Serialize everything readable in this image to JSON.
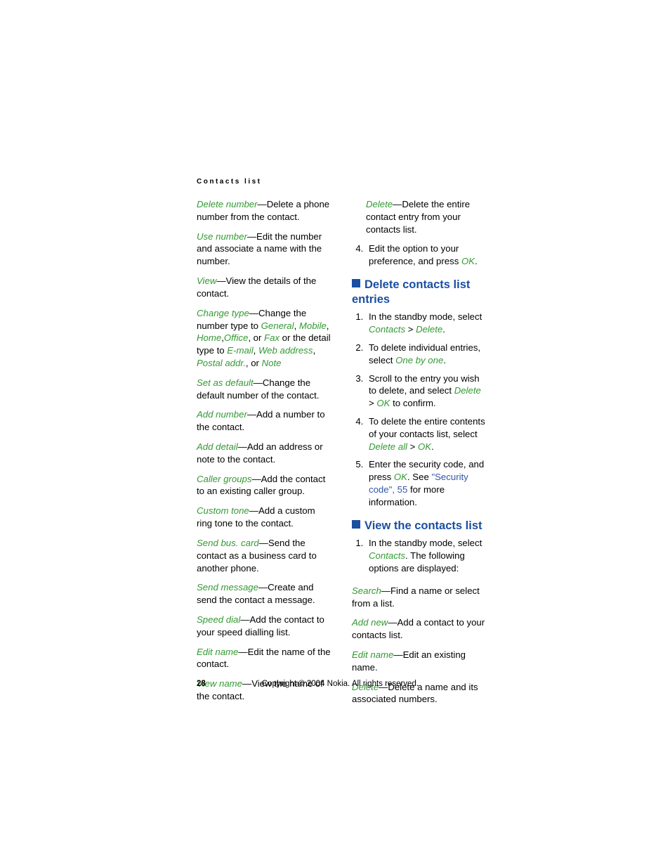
{
  "runningHead": "Contacts list",
  "pageNumber": "28",
  "copyright": "Copyright © 2004 Nokia. All rights reserved.",
  "col1": {
    "deleteNumber": {
      "t": "Delete number",
      "d": "—Delete a phone number from the contact."
    },
    "useNumber": {
      "t": "Use number",
      "d": "—Edit the number and associate a name with the number."
    },
    "view": {
      "t": "View",
      "d": "—View the details of the contact."
    },
    "changeType": {
      "t": "Change type",
      "d1": "—Change the number type to ",
      "g": "General",
      "comma1": ", ",
      "m": "Mobile",
      "comma2": ", ",
      "h": "Home",
      "comma3": ",",
      "o": "Office",
      "d2": ", or ",
      "f": "Fax",
      "d3": " or the detail type to ",
      "e": "E-mail",
      "comma4": ", ",
      "w": "Web address",
      "comma5": ", ",
      "p": "Postal addr.",
      "d4": ", or ",
      "n": "Note"
    },
    "setDefault": {
      "t": "Set as default",
      "d": "—Change the default number of the contact."
    },
    "addNumber": {
      "t": "Add number",
      "d": "—Add a number to the contact."
    },
    "addDetail": {
      "t": "Add detail",
      "d": "—Add an address or note to the contact."
    },
    "callerGroups": {
      "t": "Caller groups",
      "d": "—Add the contact to an existing caller group."
    },
    "customTone": {
      "t": "Custom tone",
      "d": "—Add a custom ring tone to the contact."
    },
    "sendBusCard": {
      "t": "Send bus. card",
      "d": "—Send the contact as a business card to another phone."
    },
    "sendMessage": {
      "t": "Send message",
      "d": "—Create and send the contact a message."
    },
    "speedDial": {
      "t": "Speed dial",
      "d": "—Add the contact to your speed dialling list."
    },
    "editName": {
      "t": "Edit name",
      "d": "—Edit the name of the contact."
    },
    "viewName": {
      "t": "View name",
      "d": "—View the name of the contact."
    }
  },
  "col2": {
    "deleteEntry": {
      "t": "Delete",
      "d": "—Delete the entire contact entry from your contacts list."
    },
    "step4": {
      "d1": "Edit the option to your preference, and press ",
      "ok": "OK",
      "d2": "."
    },
    "secDelete": {
      "title": "Delete contacts list entries",
      "s1": {
        "d1": "In the standby mode, select ",
        "c": "Contacts",
        "gt": " > ",
        "del": "Delete",
        "d2": "."
      },
      "s2": {
        "d1": "To delete individual entries, select ",
        "o": "One by one",
        "d2": "."
      },
      "s3": {
        "d1": "Scroll to the entry you wish to delete, and select ",
        "del": "Delete",
        "gt": " > ",
        "ok": "OK",
        "d2": " to confirm."
      },
      "s4": {
        "d1": "To delete the entire contents of your contacts list, select ",
        "da": "Delete all",
        "gt": " > ",
        "ok": "OK",
        "d2": "."
      },
      "s5": {
        "d1": "Enter the security code, and press ",
        "ok": "OK",
        "d2": ". See ",
        "link": "\"Security code\", 55",
        "d3": " for more information."
      }
    },
    "secView": {
      "title": "View the contacts list",
      "s1": {
        "d1": "In the standby mode, select ",
        "c": "Contacts",
        "d2": ". The following options are displayed:"
      },
      "search": {
        "t": "Search",
        "d": "—Find a name or select from a list."
      },
      "addNew": {
        "t": "Add new",
        "d": "—Add a contact to your contacts list."
      },
      "editName": {
        "t": "Edit name",
        "d": "—Edit an existing name."
      },
      "delete": {
        "t": "Delete",
        "d": "—Delete a name and its associated numbers."
      }
    }
  }
}
